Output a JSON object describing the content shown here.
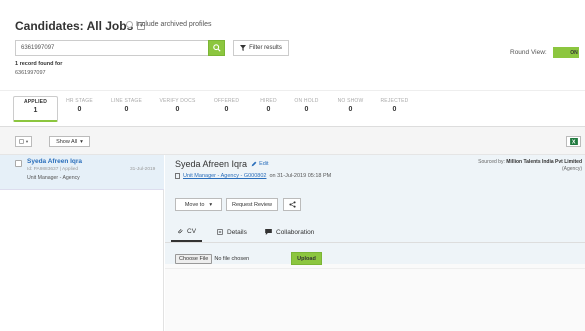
{
  "header": {
    "title": "Candidates: All Jobs",
    "include_archived": "Include archived profiles",
    "round_view_label": "Round View:",
    "round_view_toggle": "ON"
  },
  "search": {
    "value": "6361997097",
    "filter_label": "Filter results"
  },
  "records": {
    "found_text": "1 record found for",
    "query": "6361997097"
  },
  "stages": [
    {
      "label": "APPLIED",
      "count": "1"
    },
    {
      "label": "HR STAGE",
      "count": "0"
    },
    {
      "label": "LINE STAGE",
      "count": "0"
    },
    {
      "label": "VERIFY DOCS",
      "count": "0"
    },
    {
      "label": "OFFERED",
      "count": "0"
    },
    {
      "label": "HIRED",
      "count": "0"
    },
    {
      "label": "ON HOLD",
      "count": "0"
    },
    {
      "label": "NO SHOW",
      "count": "0"
    },
    {
      "label": "REJECTED",
      "count": "0"
    }
  ],
  "toolbar": {
    "show_all": "Show All"
  },
  "candidate": {
    "name": "Syeda Afreen Iqra",
    "id_status": "Id: PA9883637 | Applied",
    "date": "31-Jul-2019",
    "role": "Unit Manager - Agency"
  },
  "detail": {
    "name": "Syeda Afreen Iqra",
    "edit": "Edit",
    "sourced_prefix": "Sourced by:",
    "sourced_by": "Million Talents India Pvt Limited",
    "sourced_type": "(Agency)",
    "job_link": "Unit Manager - Agency - G000802",
    "job_date": "on 31-Jul-2019 05:18 PM",
    "move_to": "Move to",
    "request_review": "Request Review",
    "tabs": [
      "CV",
      "Details",
      "Collaboration"
    ],
    "choose_file": "Choose File",
    "no_file": "No file chosen",
    "upload": "Upload"
  },
  "colors": {
    "accent_green": "#8cc63f",
    "link_blue": "#2a6ebb",
    "selected_row": "#e6f0f8"
  }
}
